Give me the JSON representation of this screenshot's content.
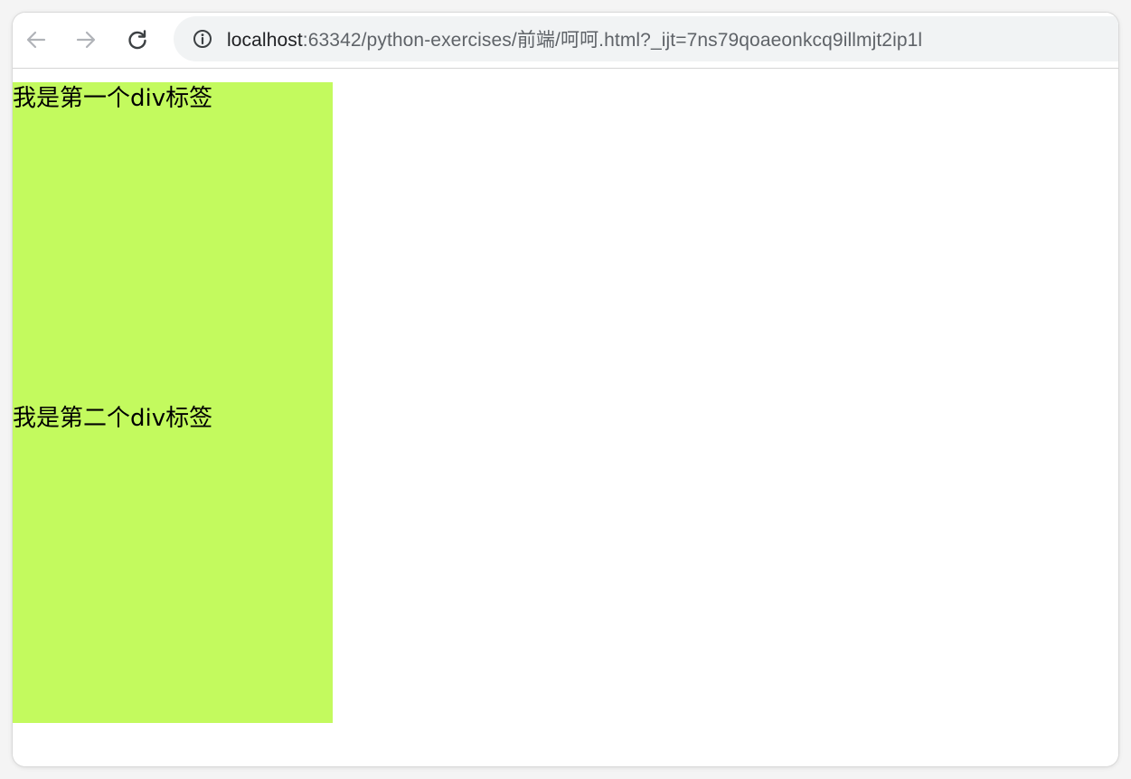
{
  "browser": {
    "url": {
      "host": "localhost",
      "rest": ":63342/python-exercises/前端/呵呵.html?_ijt=7ns79qoaeonkcq9illmjt2ip1l"
    },
    "icons": {
      "back": "arrow-left-icon",
      "forward": "arrow-right-icon",
      "reload": "reload-icon",
      "site_info": "info-icon"
    }
  },
  "page": {
    "divs": [
      {
        "text": "我是第一个div标签"
      },
      {
        "text": "我是第二个div标签"
      }
    ],
    "div_color": "#c3fa5e"
  }
}
